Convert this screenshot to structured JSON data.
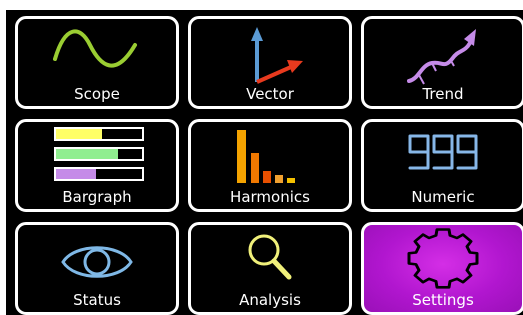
{
  "tiles": [
    {
      "label": "Scope",
      "icon": "sine-wave-icon",
      "color": "#9acd32",
      "active": false
    },
    {
      "label": "Vector",
      "icon": "vector-arrows-icon",
      "color": "#5b9bd5",
      "active": false
    },
    {
      "label": "Trend",
      "icon": "trend-curve-icon",
      "color": "#c58be8",
      "active": false
    },
    {
      "label": "Bargraph",
      "icon": "bargraph-icon",
      "color": "#90ee90",
      "active": false
    },
    {
      "label": "Harmonics",
      "icon": "harmonics-bars-icon",
      "color": "#f4a300",
      "active": false
    },
    {
      "label": "Numeric",
      "icon": "digital-999-icon",
      "color": "#87b7e8",
      "active": false
    },
    {
      "label": "Status",
      "icon": "eye-icon",
      "color": "#7fb8e6",
      "active": false
    },
    {
      "label": "Analysis",
      "icon": "magnifier-icon",
      "color": "#f0f07a",
      "active": false
    },
    {
      "label": "Settings",
      "icon": "gear-icon",
      "color": "#000000",
      "active": true
    }
  ],
  "numeric_icon_text": "999",
  "colors": {
    "background": "#000000",
    "tile_border": "#ffffff",
    "active_tile": "#b116cf"
  }
}
